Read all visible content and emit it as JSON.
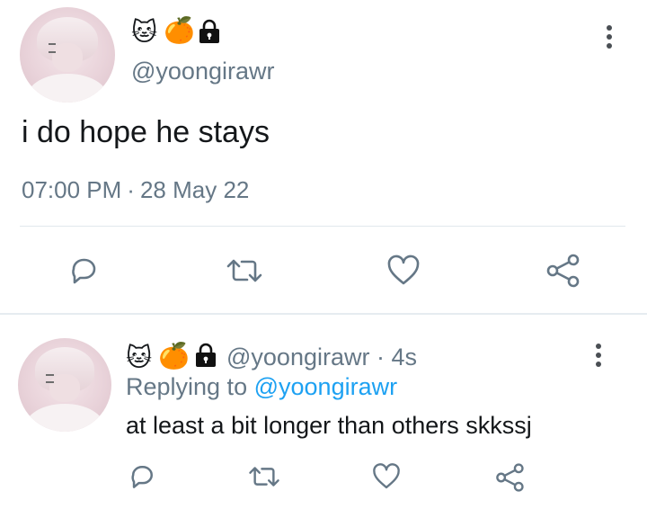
{
  "tweet": {
    "handle": "@yoongirawr",
    "badges": [
      "🐱",
      "🍊"
    ],
    "text": "i do hope he stays",
    "time": "07:00 PM",
    "separator": "·",
    "date": "28 May 22",
    "actions": [
      "reply-icon",
      "retweet-icon",
      "like-icon",
      "share-icon"
    ]
  },
  "reply": {
    "handle": "@yoongirawr",
    "separator": "·",
    "age": "4s",
    "badges": [
      "🐱",
      "🍊"
    ],
    "replying_label": "Replying to",
    "replying_handle": "@yoongirawr",
    "text": "at least a bit longer than others skkssj",
    "actions": [
      "reply-icon",
      "retweet-icon",
      "like-icon",
      "share-icon"
    ]
  },
  "colors": {
    "secondary_text": "#657786",
    "link": "#1da1f2",
    "icon": "#657786",
    "divider": "#e1e8ed"
  }
}
